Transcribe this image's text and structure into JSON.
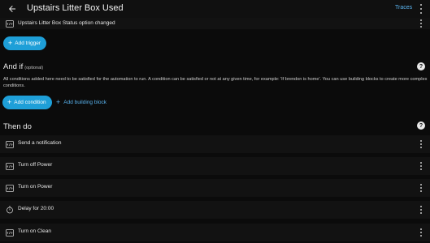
{
  "header": {
    "title": "Upstairs Litter Box Used",
    "traces_label": "Traces",
    "back_icon": "arrow-left-icon",
    "menu_icon": "more-vert-icon"
  },
  "triggers": {
    "items": [
      {
        "label": "Upstairs Litter Box Status option changed",
        "icon": "code-icon"
      }
    ],
    "add_label": "Add trigger"
  },
  "conditions": {
    "heading": "And if",
    "optional": "(optional)",
    "description": "All conditions added here need to be satisfied for the automation to run. A condition can be satisfied or not at any given time, for example: 'If brendon is home'. You can use building blocks to create more complex conditions.",
    "add_label": "Add condition",
    "building_block_label": "Add building block"
  },
  "actions": {
    "heading": "Then do",
    "items": [
      {
        "label": "Send a notification",
        "icon": "code-icon"
      },
      {
        "label": "Turn off Power",
        "icon": "code-icon"
      },
      {
        "label": "Turn on Power",
        "icon": "code-icon"
      },
      {
        "label": "Delay for 20:00",
        "icon": "timer-icon"
      },
      {
        "label": "Turn on Clean",
        "icon": "code-icon"
      }
    ]
  },
  "colors": {
    "accent": "#1e9fd8",
    "link": "#5ab4f0",
    "background": "#0b0b0b",
    "card": "#121212"
  }
}
